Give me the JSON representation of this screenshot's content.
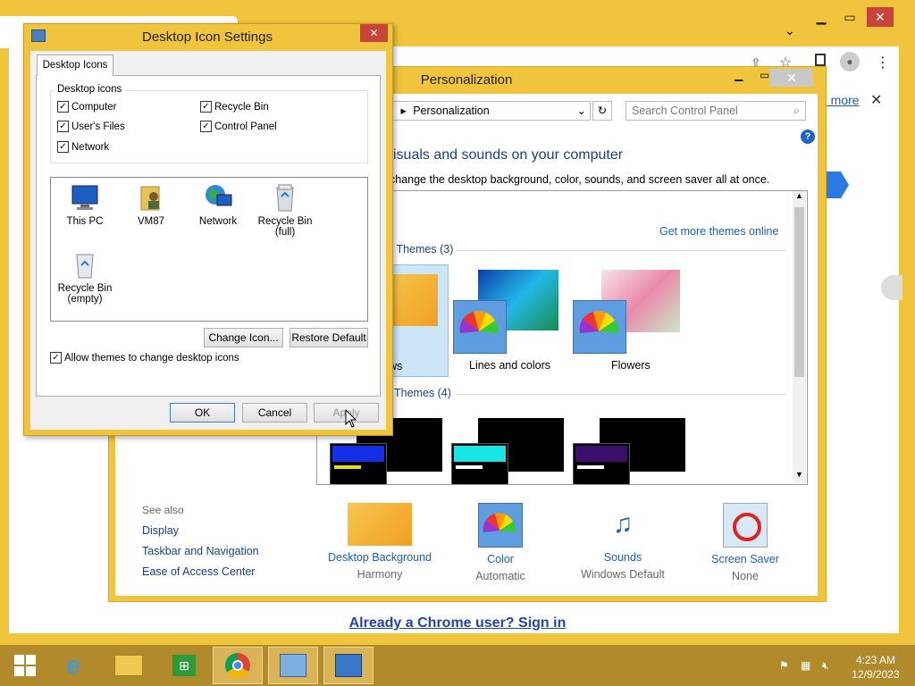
{
  "chrome": {
    "learn_more": "n more",
    "signin": "Already a Chrome user? Sign in"
  },
  "personalization": {
    "title": "Personalization",
    "breadcrumb_start": "n",
    "breadcrumb": "Personalization",
    "search_placeholder": "Search Control Panel",
    "heading": "visuals and sounds on your computer",
    "subheading": "change the desktop background, color, sounds, and screen saver all at once.",
    "my_themes_tail": ")",
    "get_more": "Get more themes online",
    "default_themes": "ult Themes (3)",
    "high_contrast": "Themes (4)",
    "themes": [
      {
        "label": "ows"
      },
      {
        "label": "Lines and colors"
      },
      {
        "label": "Flowers"
      }
    ],
    "see_also": {
      "title": "See also",
      "items": [
        "Display",
        "Taskbar and Navigation",
        "Ease of Access Center"
      ]
    },
    "bottom": [
      {
        "label": "Desktop Background",
        "value": "Harmony"
      },
      {
        "label": "Color",
        "value": "Automatic"
      },
      {
        "label": "Sounds",
        "value": "Windows Default"
      },
      {
        "label": "Screen Saver",
        "value": "None"
      }
    ]
  },
  "dialog": {
    "title": "Desktop Icon Settings",
    "tab": "Desktop Icons",
    "group_label": "Desktop icons",
    "checkboxes": [
      {
        "label": "Computer",
        "checked": true
      },
      {
        "label": "Recycle Bin",
        "checked": true
      },
      {
        "label": "User's Files",
        "checked": true
      },
      {
        "label": "Control Panel",
        "checked": true
      },
      {
        "label": "Network",
        "checked": true
      }
    ],
    "icons": [
      {
        "label": "This PC",
        "icon": "this-pc-icon"
      },
      {
        "label": "VM87",
        "icon": "user-folder-icon"
      },
      {
        "label": "Network",
        "icon": "network-icon"
      },
      {
        "label": "Recycle Bin (full)",
        "icon": "recycle-bin-full-icon"
      },
      {
        "label": "Recycle Bin (empty)",
        "icon": "recycle-bin-empty-icon"
      }
    ],
    "change_icon": "Change Icon...",
    "restore_default": "Restore Default",
    "allow_themes": "Allow themes to change desktop icons",
    "ok": "OK",
    "cancel": "Cancel",
    "apply": "Apply"
  },
  "taskbar": {
    "time": "4:23 AM",
    "date": "12/9/2023"
  }
}
